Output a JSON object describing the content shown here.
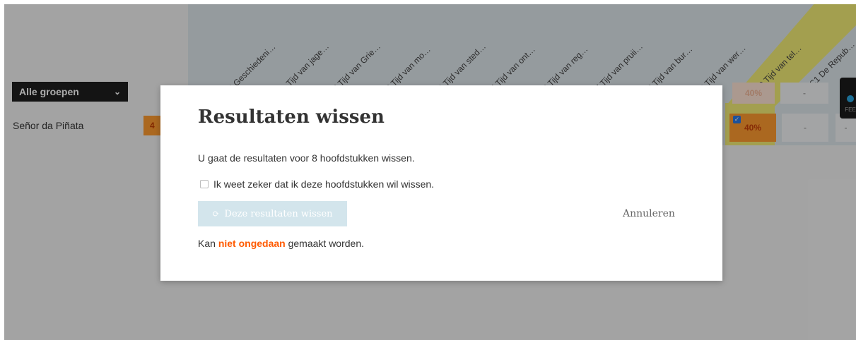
{
  "header": {
    "columns": [
      "0 Geschiedeni…",
      "1 Tijd van jage…",
      "2 Tijd van Grie…",
      "3 Tijd van mo…",
      "4 Tijd van sted…",
      "5 Tijd van ont…",
      "6 Tijd van reg…",
      "7 Tijd van pruii…",
      "8 Tijd van bur…",
      "9 Tijd van wer…",
      "10 Tijd van tel…",
      "HC1 De Repub…"
    ],
    "selected_column_index": 10
  },
  "filters": {
    "group_select": {
      "value": "Alle groepen"
    }
  },
  "table": {
    "header_row": {
      "percent": "40%",
      "dash": "-"
    },
    "rows": [
      {
        "name": "Señor da Piñata",
        "score_chip": "4",
        "selected_percent": "40%",
        "selected_checked": true,
        "dashes": [
          "-",
          "-"
        ]
      }
    ]
  },
  "feedback_tab": {
    "label": "FEE"
  },
  "modal": {
    "title": "Resultaten wissen",
    "description": "U gaat de resultaten voor 8 hoofdstukken wissen.",
    "confirm_label": "Ik weet zeker dat ik deze hoofdstukken wil wissen.",
    "confirm_checked": false,
    "delete_button": "Deze resultaten wissen",
    "cancel_link": "Annuleren",
    "warning_prefix": "Kan",
    "warning_emphasis": "niet ongedaan",
    "warning_suffix": "gemaakt worden."
  },
  "colors": {
    "accent_orange": "#ff5a00",
    "score_orange": "#ff9b30",
    "highlight_yellow": "#f3ee76",
    "disabled_button": "#d3e5ec"
  },
  "icons": {
    "group_select": "chevron-down-icon",
    "delete_button": "refresh-icon",
    "row_check": "checkbox-checked-icon"
  }
}
